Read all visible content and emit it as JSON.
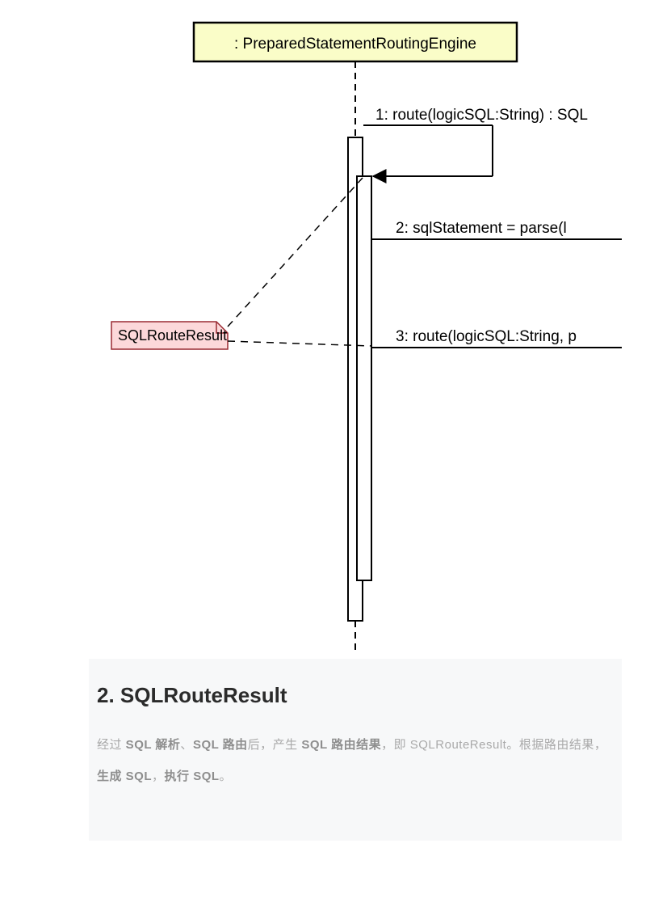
{
  "diagram": {
    "actor": ": PreparedStatementRoutingEngine",
    "note": "SQLRouteResult",
    "messages": {
      "m1": "1: route(logicSQL:String) : SQL",
      "m2": "2: sqlStatement = parse(l",
      "m3": "3: route(logicSQL:String, p"
    }
  },
  "section": {
    "title": "2. SQLRouteResult",
    "para": {
      "t1": "经过",
      "b1": " SQL 解析",
      "t2": "、",
      "b2": "SQL 路由",
      "t3": "后，产生",
      "b3": " SQL 路由结果",
      "t4": "，即 SQLRouteResult。根据路由结果，",
      "b4": "生成 SQL",
      "t5": "，",
      "b5": "执行 SQL",
      "t6": "。"
    }
  }
}
